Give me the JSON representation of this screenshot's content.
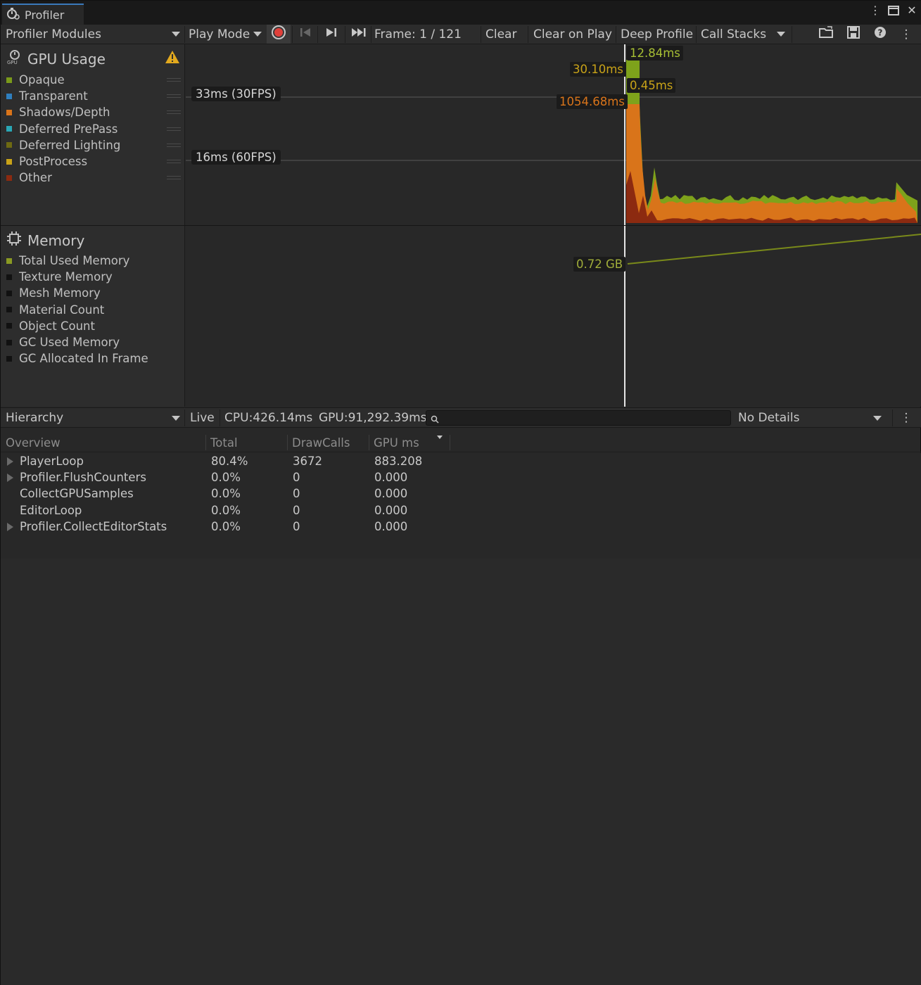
{
  "window": {
    "tab_title": "Profiler"
  },
  "toolbar": {
    "modules_dropdown": "Profiler Modules",
    "play_mode": "Play Mode",
    "frame": "Frame: 1 / 121",
    "clear": "Clear",
    "clear_on_play": "Clear on Play",
    "deep_profile": "Deep Profile",
    "call_stacks": "Call Stacks"
  },
  "gpu_module": {
    "title": "GPU Usage",
    "legend": [
      {
        "label": "Opaque",
        "color": "#7a9a1a"
      },
      {
        "label": "Transparent",
        "color": "#2f7fbf"
      },
      {
        "label": "Shadows/Depth",
        "color": "#d9741a"
      },
      {
        "label": "Deferred PrePass",
        "color": "#2aa7b5"
      },
      {
        "label": "Deferred Lighting",
        "color": "#6e6a12"
      },
      {
        "label": "PostProcess",
        "color": "#c9a318"
      },
      {
        "label": "Other",
        "color": "#8c2a10"
      }
    ],
    "ref_30fps": "33ms (30FPS)",
    "ref_60fps": "16ms (60FPS)",
    "value_labels": {
      "v1": "12.84ms",
      "v2": "30.10ms",
      "v3": "0.45ms",
      "v4": "1054.68ms"
    }
  },
  "memory_module": {
    "title": "Memory",
    "legend": [
      {
        "label": "Total Used Memory",
        "color": "#8a9a22"
      },
      {
        "label": "Texture Memory",
        "color": "#111111"
      },
      {
        "label": "Mesh Memory",
        "color": "#111111"
      },
      {
        "label": "Material Count",
        "color": "#111111"
      },
      {
        "label": "Object Count",
        "color": "#111111"
      },
      {
        "label": "GC Used Memory",
        "color": "#111111"
      },
      {
        "label": "GC Allocated In Frame",
        "color": "#111111"
      }
    ],
    "value_label": "0.72 GB"
  },
  "hierarchy_bar": {
    "view_dropdown": "Hierarchy",
    "live": "Live",
    "cpu": "CPU:426.14ms",
    "gpu": "GPU:91,292.39ms",
    "search_placeholder": "",
    "details_dropdown": "No Details"
  },
  "table": {
    "headers": [
      "Overview",
      "Total",
      "DrawCalls",
      "GPU ms"
    ],
    "rows": [
      {
        "name": "PlayerLoop",
        "total": "80.4%",
        "drawcalls": "3672",
        "gpu_ms": "883.208",
        "expandable": true
      },
      {
        "name": "Profiler.FlushCounters",
        "total": "0.0%",
        "drawcalls": "0",
        "gpu_ms": "0.000",
        "expandable": true
      },
      {
        "name": "CollectGPUSamples",
        "total": "0.0%",
        "drawcalls": "0",
        "gpu_ms": "0.000",
        "expandable": false
      },
      {
        "name": "EditorLoop",
        "total": "0.0%",
        "drawcalls": "0",
        "gpu_ms": "0.000",
        "expandable": false
      },
      {
        "name": "Profiler.CollectEditorStats",
        "total": "0.0%",
        "drawcalls": "0",
        "gpu_ms": "0.000",
        "expandable": true
      }
    ]
  }
}
